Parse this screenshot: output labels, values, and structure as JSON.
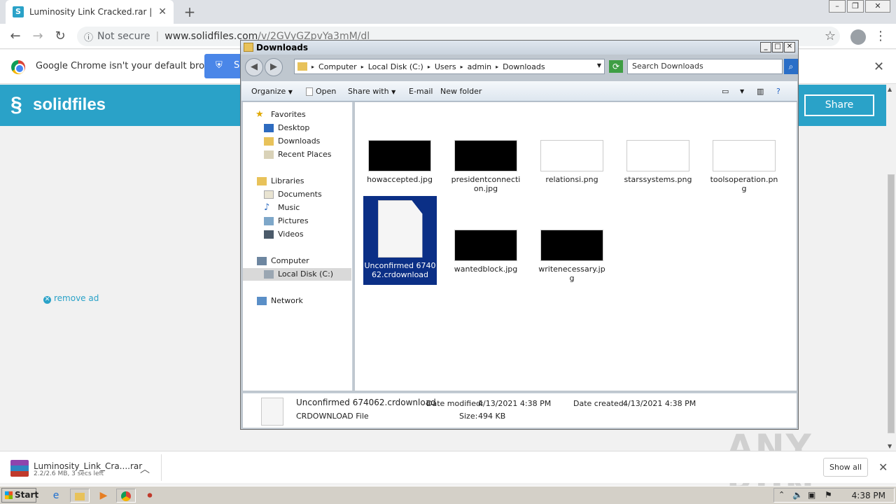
{
  "browser": {
    "tab_title": "Luminosity Link Cracked.rar | Solidfile",
    "url_status": "Not secure",
    "url_host": "www.solidfiles.com",
    "url_path": "/v/2GVyGZpvYa3mM/dl"
  },
  "infobar": {
    "message": "Google Chrome isn't your default browser",
    "button_label": "S"
  },
  "site": {
    "logo_text": "solidfiles",
    "share_label": "Share",
    "remove_ad": "remove ad"
  },
  "download_shelf": {
    "file_name": "Luminosity_Link_Cra....rar",
    "status": "2.2/2.6 MB, 3 secs left",
    "show_all": "Show all"
  },
  "watermark": "ANY RUN",
  "taskbar": {
    "start": "Start",
    "time": "4:38 PM"
  },
  "explorer": {
    "title": "Downloads",
    "breadcrumb": [
      "Computer",
      "Local Disk (C:)",
      "Users",
      "admin",
      "Downloads"
    ],
    "search_placeholder": "Search Downloads",
    "commands": {
      "organize": "Organize",
      "open": "Open",
      "share_with": "Share with",
      "email": "E-mail",
      "new_folder": "New folder"
    },
    "nav": {
      "favorites": "Favorites",
      "desktop": "Desktop",
      "downloads": "Downloads",
      "recent": "Recent Places",
      "libraries": "Libraries",
      "documents": "Documents",
      "music": "Music",
      "pictures": "Pictures",
      "videos": "Videos",
      "computer": "Computer",
      "local_disk": "Local Disk (C:)",
      "network": "Network"
    },
    "files": [
      {
        "name": "howaccepted.jpg"
      },
      {
        "name": "presidentconnection.jpg"
      },
      {
        "name": "relationsi.png"
      },
      {
        "name": "starssystems.png"
      },
      {
        "name": "toolsoperation.png"
      },
      {
        "name": "Unconfirmed 674062.crdownload"
      },
      {
        "name": "wantedblock.jpg"
      },
      {
        "name": "writenecessary.jpg"
      }
    ],
    "details": {
      "name": "Unconfirmed 674062.crdownload",
      "type": "CRDOWNLOAD File",
      "modified_label": "Date modified:",
      "modified_value": "4/13/2021 4:38 PM",
      "created_label": "Date created:",
      "created_value": "4/13/2021 4:38 PM",
      "size_label": "Size:",
      "size_value": "494 KB"
    }
  }
}
